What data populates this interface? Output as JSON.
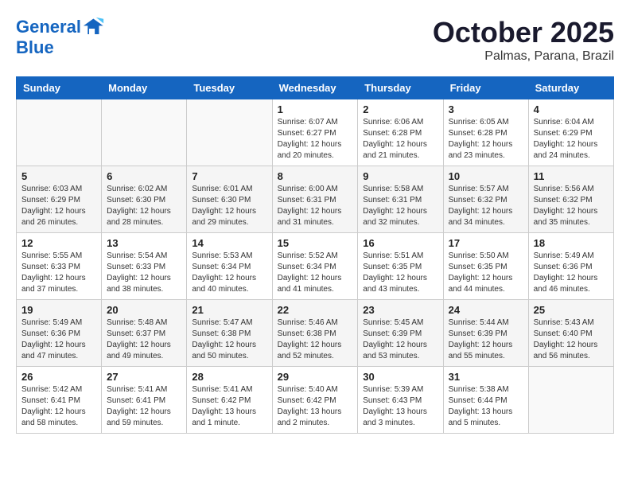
{
  "header": {
    "logo_line1": "General",
    "logo_line2": "Blue",
    "month": "October 2025",
    "location": "Palmas, Parana, Brazil"
  },
  "days_of_week": [
    "Sunday",
    "Monday",
    "Tuesday",
    "Wednesday",
    "Thursday",
    "Friday",
    "Saturday"
  ],
  "weeks": [
    [
      {
        "num": "",
        "info": ""
      },
      {
        "num": "",
        "info": ""
      },
      {
        "num": "",
        "info": ""
      },
      {
        "num": "1",
        "info": "Sunrise: 6:07 AM\nSunset: 6:27 PM\nDaylight: 12 hours\nand 20 minutes."
      },
      {
        "num": "2",
        "info": "Sunrise: 6:06 AM\nSunset: 6:28 PM\nDaylight: 12 hours\nand 21 minutes."
      },
      {
        "num": "3",
        "info": "Sunrise: 6:05 AM\nSunset: 6:28 PM\nDaylight: 12 hours\nand 23 minutes."
      },
      {
        "num": "4",
        "info": "Sunrise: 6:04 AM\nSunset: 6:29 PM\nDaylight: 12 hours\nand 24 minutes."
      }
    ],
    [
      {
        "num": "5",
        "info": "Sunrise: 6:03 AM\nSunset: 6:29 PM\nDaylight: 12 hours\nand 26 minutes."
      },
      {
        "num": "6",
        "info": "Sunrise: 6:02 AM\nSunset: 6:30 PM\nDaylight: 12 hours\nand 28 minutes."
      },
      {
        "num": "7",
        "info": "Sunrise: 6:01 AM\nSunset: 6:30 PM\nDaylight: 12 hours\nand 29 minutes."
      },
      {
        "num": "8",
        "info": "Sunrise: 6:00 AM\nSunset: 6:31 PM\nDaylight: 12 hours\nand 31 minutes."
      },
      {
        "num": "9",
        "info": "Sunrise: 5:58 AM\nSunset: 6:31 PM\nDaylight: 12 hours\nand 32 minutes."
      },
      {
        "num": "10",
        "info": "Sunrise: 5:57 AM\nSunset: 6:32 PM\nDaylight: 12 hours\nand 34 minutes."
      },
      {
        "num": "11",
        "info": "Sunrise: 5:56 AM\nSunset: 6:32 PM\nDaylight: 12 hours\nand 35 minutes."
      }
    ],
    [
      {
        "num": "12",
        "info": "Sunrise: 5:55 AM\nSunset: 6:33 PM\nDaylight: 12 hours\nand 37 minutes."
      },
      {
        "num": "13",
        "info": "Sunrise: 5:54 AM\nSunset: 6:33 PM\nDaylight: 12 hours\nand 38 minutes."
      },
      {
        "num": "14",
        "info": "Sunrise: 5:53 AM\nSunset: 6:34 PM\nDaylight: 12 hours\nand 40 minutes."
      },
      {
        "num": "15",
        "info": "Sunrise: 5:52 AM\nSunset: 6:34 PM\nDaylight: 12 hours\nand 41 minutes."
      },
      {
        "num": "16",
        "info": "Sunrise: 5:51 AM\nSunset: 6:35 PM\nDaylight: 12 hours\nand 43 minutes."
      },
      {
        "num": "17",
        "info": "Sunrise: 5:50 AM\nSunset: 6:35 PM\nDaylight: 12 hours\nand 44 minutes."
      },
      {
        "num": "18",
        "info": "Sunrise: 5:49 AM\nSunset: 6:36 PM\nDaylight: 12 hours\nand 46 minutes."
      }
    ],
    [
      {
        "num": "19",
        "info": "Sunrise: 5:49 AM\nSunset: 6:36 PM\nDaylight: 12 hours\nand 47 minutes."
      },
      {
        "num": "20",
        "info": "Sunrise: 5:48 AM\nSunset: 6:37 PM\nDaylight: 12 hours\nand 49 minutes."
      },
      {
        "num": "21",
        "info": "Sunrise: 5:47 AM\nSunset: 6:38 PM\nDaylight: 12 hours\nand 50 minutes."
      },
      {
        "num": "22",
        "info": "Sunrise: 5:46 AM\nSunset: 6:38 PM\nDaylight: 12 hours\nand 52 minutes."
      },
      {
        "num": "23",
        "info": "Sunrise: 5:45 AM\nSunset: 6:39 PM\nDaylight: 12 hours\nand 53 minutes."
      },
      {
        "num": "24",
        "info": "Sunrise: 5:44 AM\nSunset: 6:39 PM\nDaylight: 12 hours\nand 55 minutes."
      },
      {
        "num": "25",
        "info": "Sunrise: 5:43 AM\nSunset: 6:40 PM\nDaylight: 12 hours\nand 56 minutes."
      }
    ],
    [
      {
        "num": "26",
        "info": "Sunrise: 5:42 AM\nSunset: 6:41 PM\nDaylight: 12 hours\nand 58 minutes."
      },
      {
        "num": "27",
        "info": "Sunrise: 5:41 AM\nSunset: 6:41 PM\nDaylight: 12 hours\nand 59 minutes."
      },
      {
        "num": "28",
        "info": "Sunrise: 5:41 AM\nSunset: 6:42 PM\nDaylight: 13 hours\nand 1 minute."
      },
      {
        "num": "29",
        "info": "Sunrise: 5:40 AM\nSunset: 6:42 PM\nDaylight: 13 hours\nand 2 minutes."
      },
      {
        "num": "30",
        "info": "Sunrise: 5:39 AM\nSunset: 6:43 PM\nDaylight: 13 hours\nand 3 minutes."
      },
      {
        "num": "31",
        "info": "Sunrise: 5:38 AM\nSunset: 6:44 PM\nDaylight: 13 hours\nand 5 minutes."
      },
      {
        "num": "",
        "info": ""
      }
    ]
  ]
}
